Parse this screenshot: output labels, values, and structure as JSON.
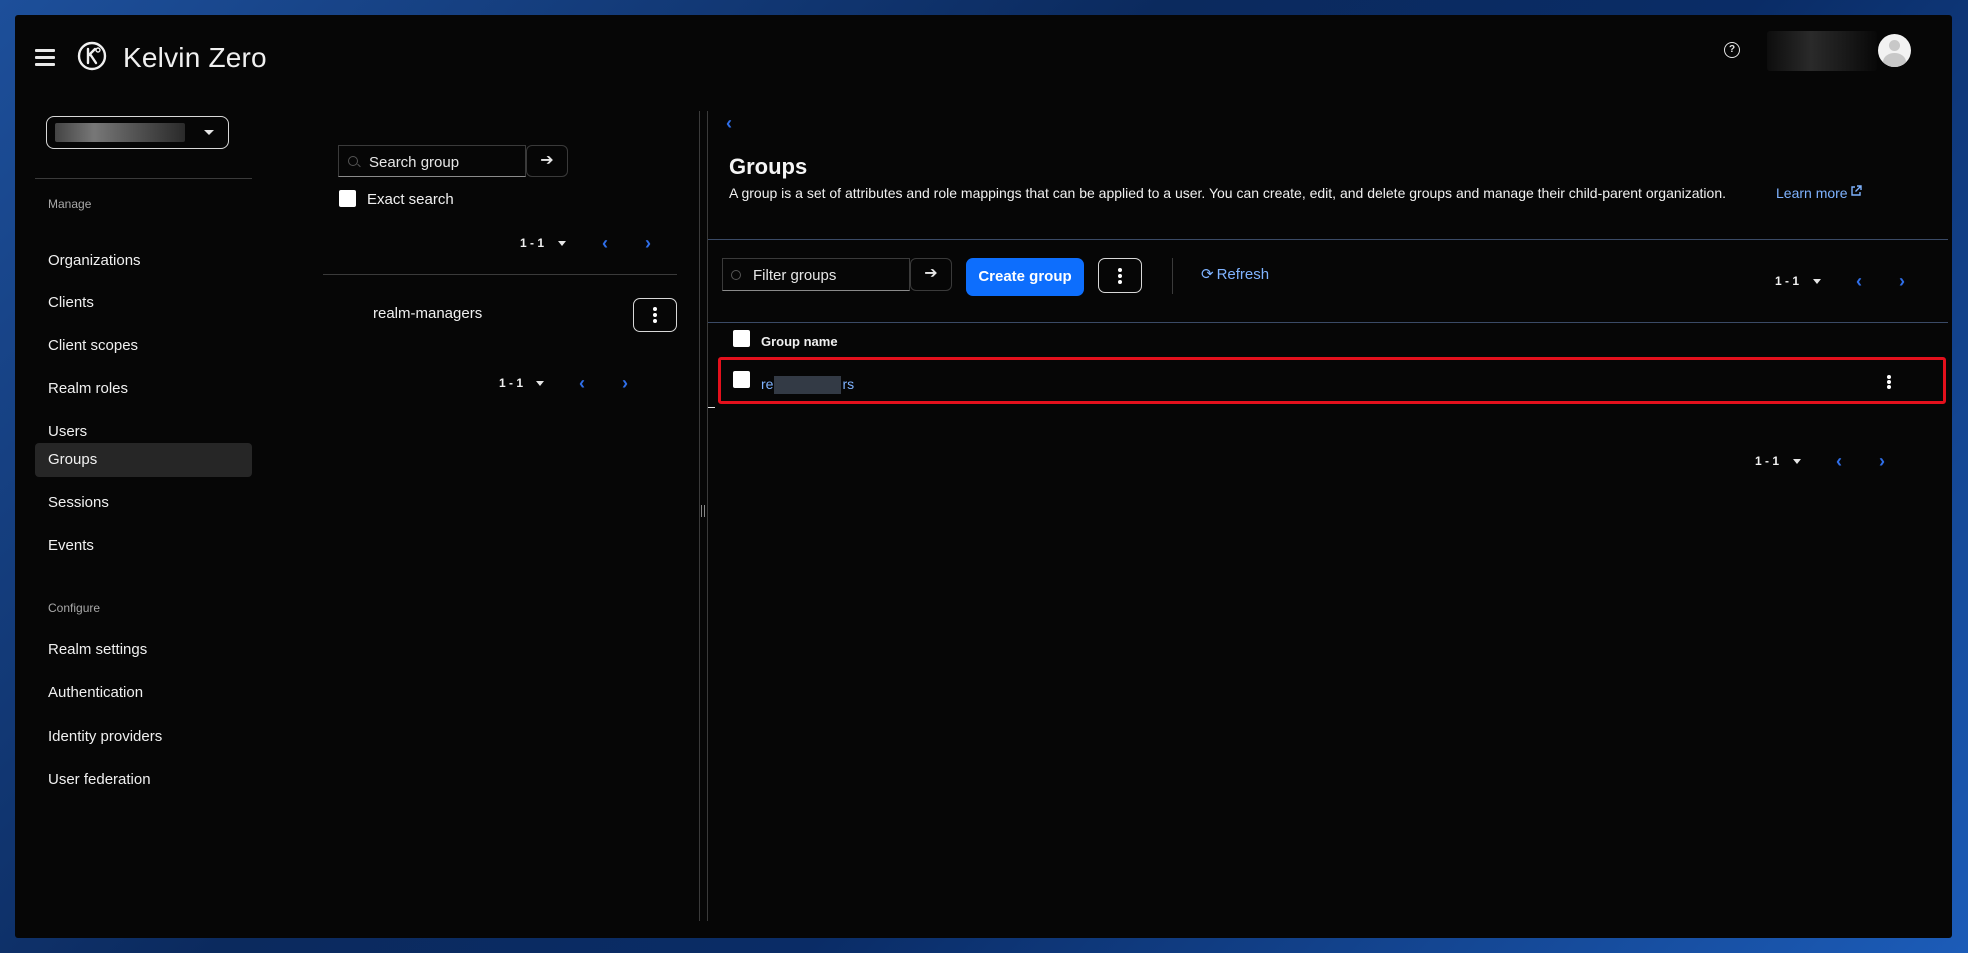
{
  "header": {
    "brand": "Kelvin Zero",
    "help_symbol": "?",
    "icons": [
      "hamburger-menu-icon",
      "kelvin-zero-logo-icon",
      "help-icon",
      "user-avatar-icon"
    ]
  },
  "sidebar": {
    "sections": [
      {
        "title": "Manage",
        "items": [
          {
            "label": "Organizations"
          },
          {
            "label": "Clients"
          },
          {
            "label": "Client scopes"
          },
          {
            "label": "Realm roles"
          },
          {
            "label": "Users"
          },
          {
            "label": "Groups",
            "active": true
          },
          {
            "label": "Sessions"
          },
          {
            "label": "Events"
          }
        ]
      },
      {
        "title": "Configure",
        "items": [
          {
            "label": "Realm settings"
          },
          {
            "label": "Authentication"
          },
          {
            "label": "Identity providers"
          },
          {
            "label": "User federation"
          }
        ]
      }
    ]
  },
  "tree_panel": {
    "search_placeholder": "Search group",
    "exact_search_label": "Exact search",
    "pagination_top": "1 - 1",
    "pagination_bottom": "1 - 1",
    "tree_items": [
      {
        "label": "realm-managers"
      }
    ]
  },
  "main": {
    "title": "Groups",
    "description": "A group is a set of attributes and role mappings that can be applied to a user. You can create, edit, and delete groups and manage their child-parent organization.",
    "learn_more": "Learn more",
    "filter_placeholder": "Filter groups",
    "create_button": "Create group",
    "refresh_label": "Refresh",
    "pagination_top": "1 - 1",
    "pagination_bottom": "1 - 1",
    "table": {
      "columns": [
        "Group name"
      ],
      "rows": [
        {
          "name_prefix": "re",
          "name_suffix": "rs"
        }
      ]
    },
    "highlight_color": "#e3101c",
    "accent_color": "#0d6efd",
    "link_color": "#7fb3ff"
  }
}
